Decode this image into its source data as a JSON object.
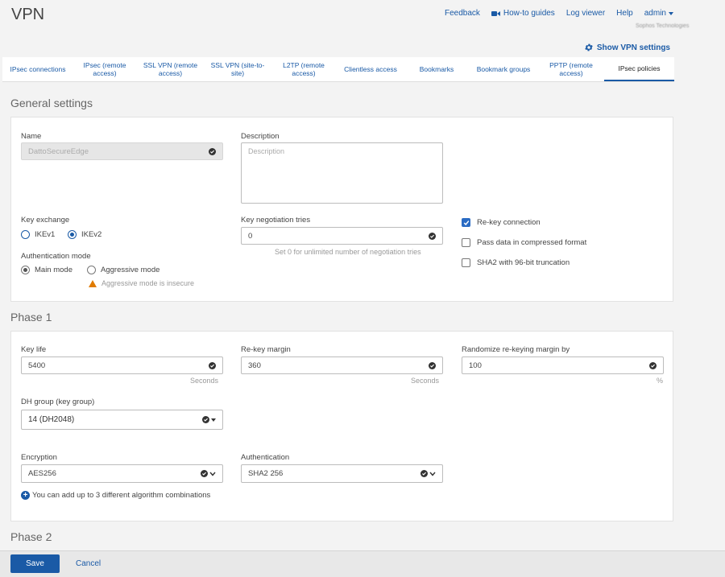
{
  "header": {
    "title": "VPN",
    "links": {
      "feedback": "Feedback",
      "howto": "How-to guides",
      "logviewer": "Log viewer",
      "help": "Help",
      "admin": "admin"
    },
    "org_name": "Sophos Technologies",
    "show_vpn_settings": "Show VPN settings"
  },
  "tabs": [
    {
      "label": "IPsec connections"
    },
    {
      "label": "IPsec (remote access)"
    },
    {
      "label": "SSL VPN (remote access)"
    },
    {
      "label": "SSL VPN (site-to-site)"
    },
    {
      "label": "L2TP (remote access)"
    },
    {
      "label": "Clientless access"
    },
    {
      "label": "Bookmarks"
    },
    {
      "label": "Bookmark groups"
    },
    {
      "label": "PPTP (remote access)"
    },
    {
      "label": "IPsec policies",
      "active": true
    }
  ],
  "general": {
    "section_title": "General settings",
    "name_label": "Name",
    "name_value": "DattoSecureEdge",
    "description_label": "Description",
    "description_placeholder": "Description",
    "key_exchange_label": "Key exchange",
    "ikev1": "IKEv1",
    "ikev2": "IKEv2",
    "key_exchange_selected": "IKEv2",
    "key_negotiation_label": "Key negotiation tries",
    "key_negotiation_value": "0",
    "key_negotiation_hint": "Set 0 for unlimited number of negotiation tries",
    "rekey_label": "Re-key connection",
    "rekey_checked": true,
    "compress_label": "Pass data in compressed format",
    "compress_checked": false,
    "sha2_label": "SHA2 with 96-bit truncation",
    "sha2_checked": false,
    "auth_mode_label": "Authentication mode",
    "main_mode": "Main mode",
    "aggressive_mode": "Aggressive mode",
    "auth_mode_selected": "Main mode",
    "aggressive_warning": "Aggressive mode is insecure"
  },
  "phase1": {
    "section_title": "Phase 1",
    "key_life_label": "Key life",
    "key_life_value": "5400",
    "key_life_unit": "Seconds",
    "rekey_margin_label": "Re-key margin",
    "rekey_margin_value": "360",
    "rekey_margin_unit": "Seconds",
    "randomize_label": "Randomize re-keying margin by",
    "randomize_value": "100",
    "randomize_unit": "%",
    "dh_group_label": "DH group (key group)",
    "dh_group_value": "14 (DH2048)",
    "encryption_label": "Encryption",
    "encryption_value": "AES256",
    "authentication_label": "Authentication",
    "authentication_value": "SHA2 256",
    "info_text": "You can add up to 3 different algorithm combinations"
  },
  "phase2": {
    "section_title": "Phase 2"
  },
  "footer": {
    "save": "Save",
    "cancel": "Cancel"
  },
  "colors": {
    "accent": "#1a5aa6",
    "warning": "#e07b00"
  }
}
